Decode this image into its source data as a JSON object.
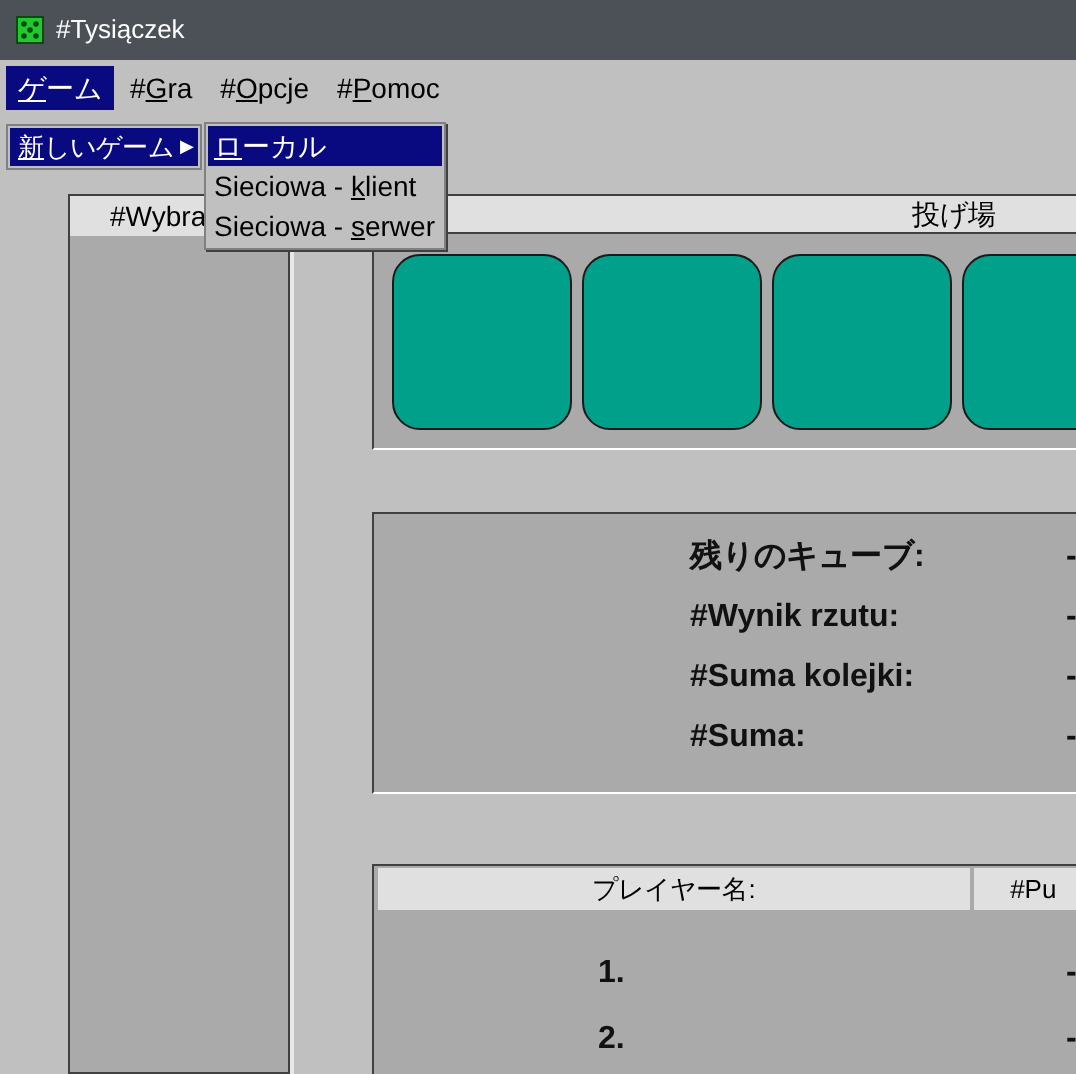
{
  "window": {
    "title": "#Tysiączek"
  },
  "menu_bar": [
    {
      "parts": [
        "ゲ",
        "ーム"
      ],
      "selected": true
    },
    {
      "parts": [
        "#",
        "G",
        "ra"
      ],
      "selected": false
    },
    {
      "parts": [
        "#",
        "O",
        "pcje"
      ],
      "selected": false
    },
    {
      "parts": [
        "#",
        "P",
        "omoc"
      ],
      "selected": false
    }
  ],
  "submenu": {
    "parts": [
      "新",
      "しいゲーム"
    ],
    "arrow": "▶",
    "selected": true
  },
  "submenu_2": [
    {
      "parts": [
        "ロ",
        "ーカル"
      ],
      "selected": true
    },
    {
      "parts": [
        "Sieciowa - ",
        "k",
        "lient"
      ],
      "selected": false
    },
    {
      "parts": [
        "Sieciowa - ",
        "s",
        "erwer"
      ],
      "selected": false
    }
  ],
  "left_panel": {
    "header": "#Wybra"
  },
  "throw_area": {
    "header": "投げ場",
    "dice": [
      {
        "color": "#00a08a"
      },
      {
        "color": "#00a08a"
      },
      {
        "color": "#00a08a"
      },
      {
        "color": "#00a08a"
      }
    ]
  },
  "stats": [
    {
      "label": "残りのキューブ:",
      "value": "-"
    },
    {
      "label": "#Wynik rzutu:",
      "value": "-"
    },
    {
      "label": "#Suma kolejki:",
      "value": "-"
    },
    {
      "label": "#Suma:",
      "value": "-"
    }
  ],
  "score_table": {
    "columns": [
      "プレイヤー名:",
      "#Pu"
    ],
    "rows": [
      {
        "rank": "1.",
        "points": "-"
      },
      {
        "rank": "2.",
        "points": "-"
      }
    ]
  }
}
